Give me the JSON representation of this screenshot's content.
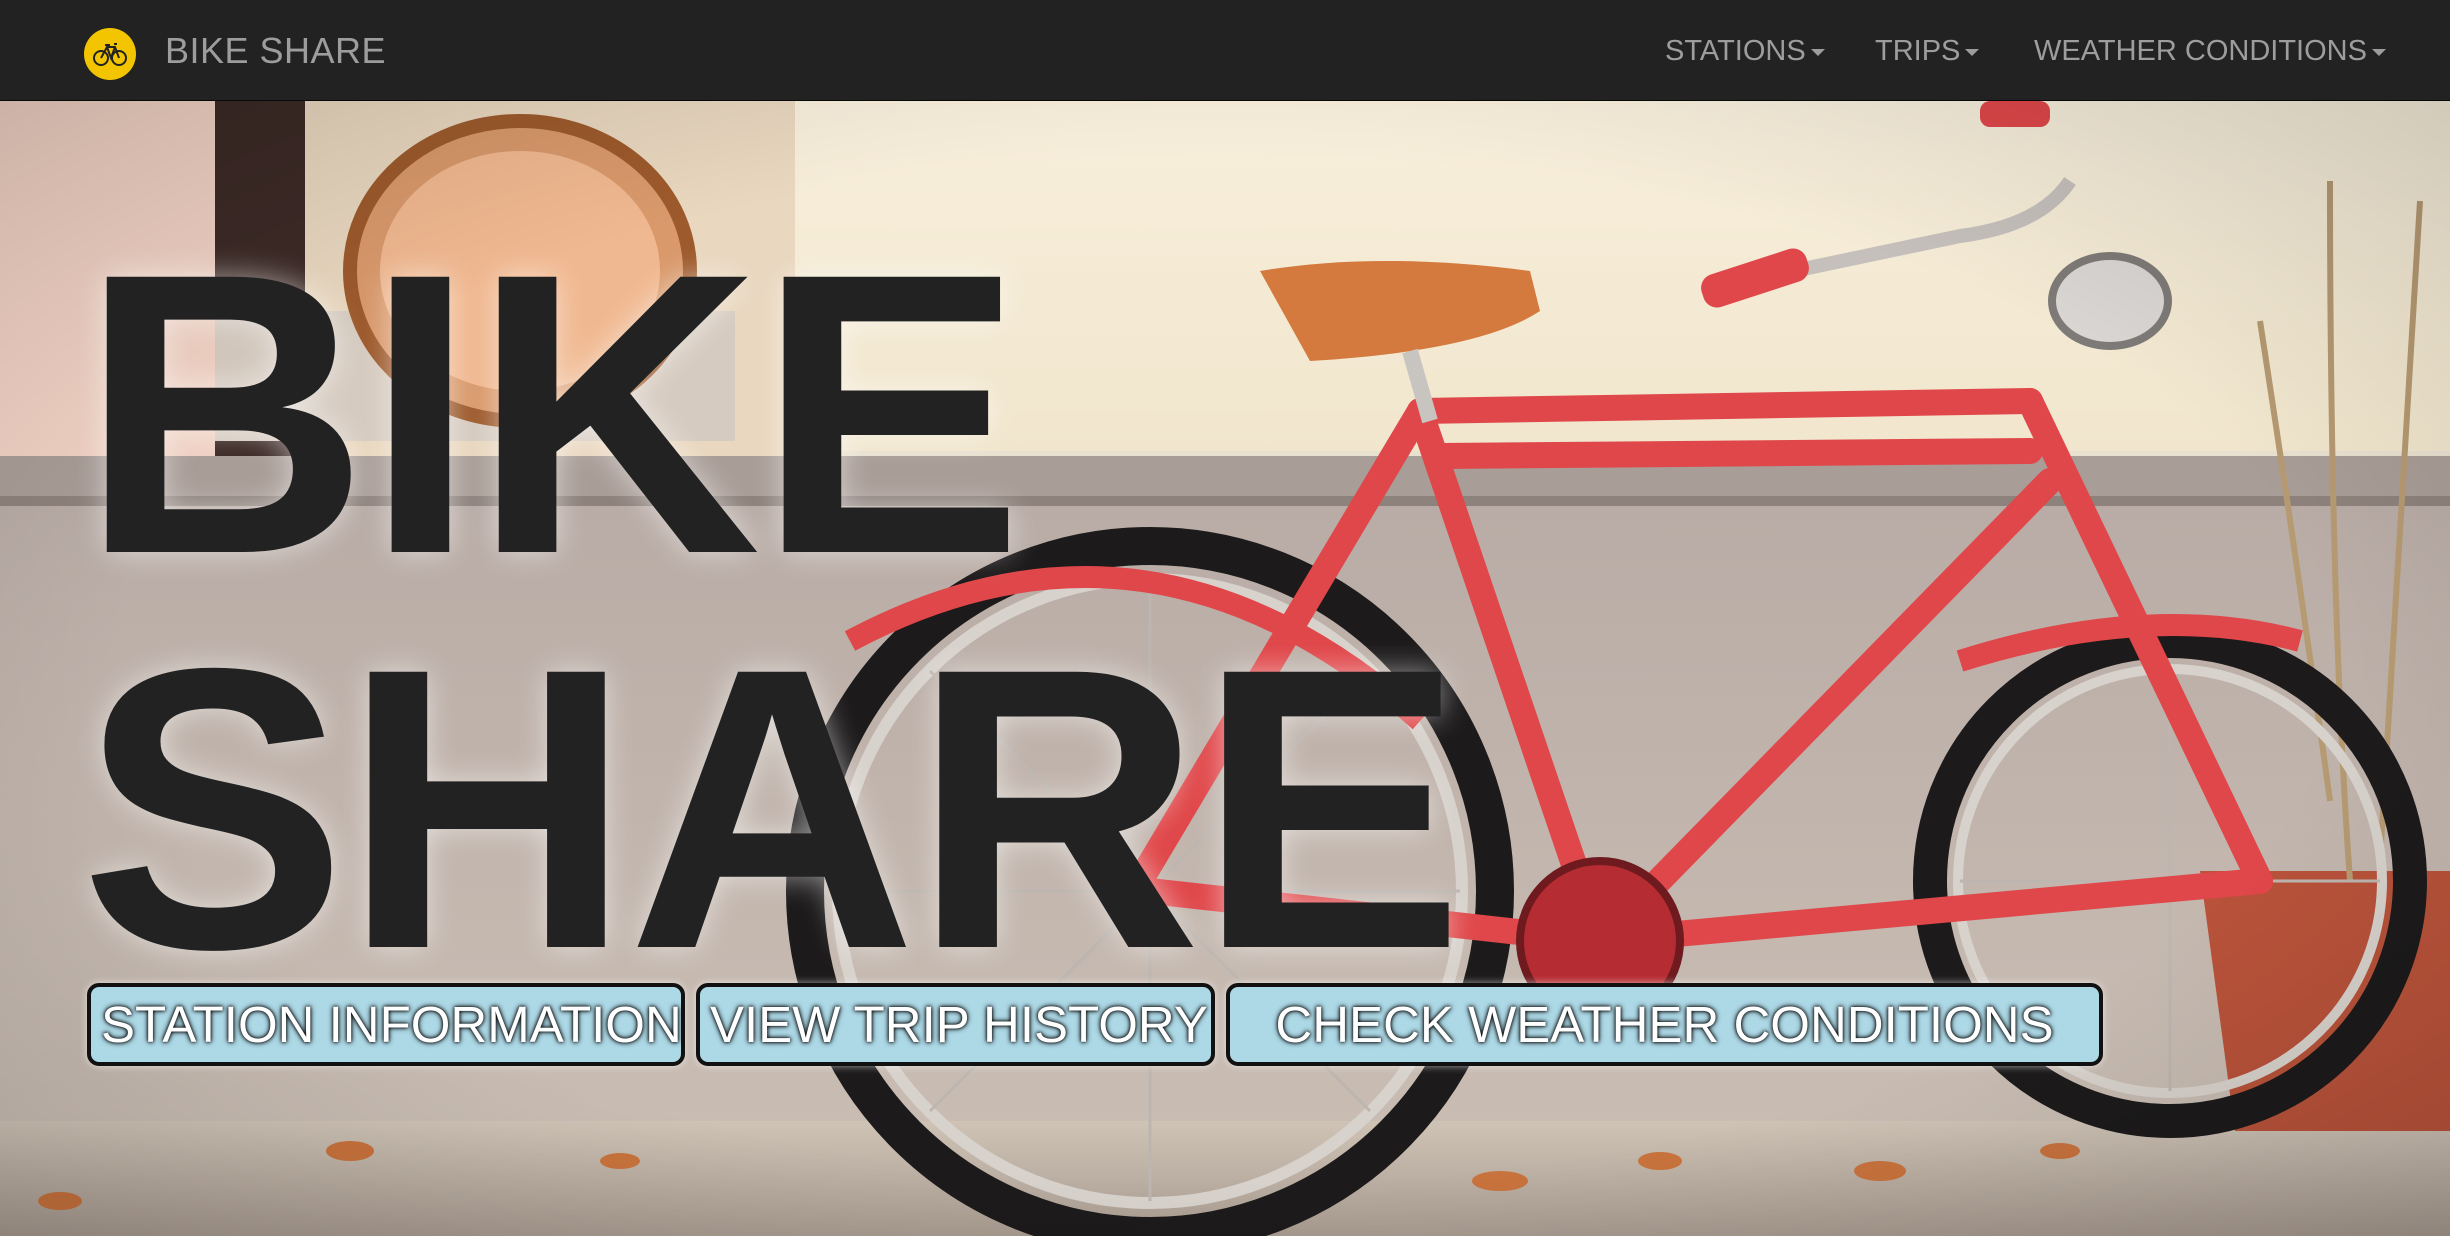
{
  "navbar": {
    "brand": "BIKE SHARE",
    "logo_icon": "bicycle-icon",
    "menu": [
      {
        "label": "STATIONS"
      },
      {
        "label": "TRIPS"
      },
      {
        "label": "WEATHER CONDITIONS"
      }
    ]
  },
  "hero": {
    "title_line1": "BIKE",
    "title_line2": "SHARE",
    "buttons": [
      {
        "label": "STATION INFORMATION"
      },
      {
        "label": "VIEW TRIP HISTORY"
      },
      {
        "label": "CHECK WEATHER CONDITIONS"
      }
    ],
    "background_image": "red-bicycle-photo"
  },
  "colors": {
    "navbar_bg": "#222222",
    "navbar_text": "#9d9d9d",
    "logo_yellow": "#f2c500",
    "title_text": "#222222",
    "button_bg": "#add8e6",
    "bike_red": "#e0474a"
  }
}
